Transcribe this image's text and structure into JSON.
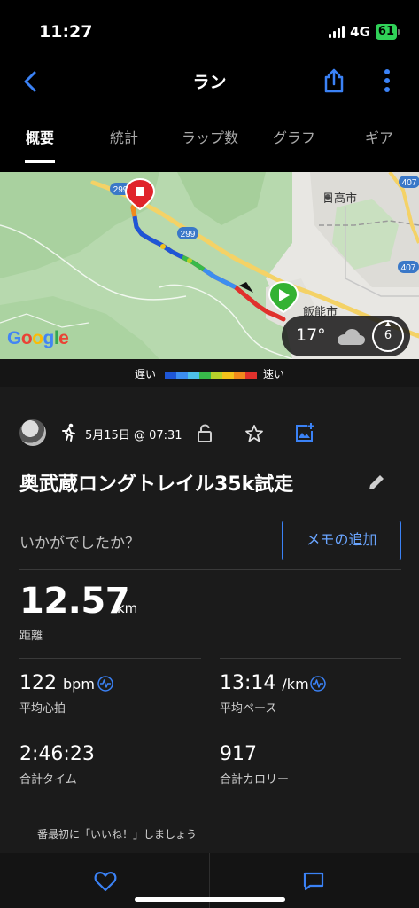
{
  "status_bar": {
    "time": "11:27",
    "network": "4G",
    "battery": "61"
  },
  "nav": {
    "title": "ラン"
  },
  "tabs": [
    {
      "label": "概要"
    },
    {
      "label": "統計"
    },
    {
      "label": "ラップ数"
    },
    {
      "label": "グラフ"
    },
    {
      "label": "ギア"
    }
  ],
  "map": {
    "place_labels": [
      "日高市",
      "飯能市"
    ],
    "road_numbers": [
      "299",
      "299",
      "407",
      "407"
    ],
    "weather": {
      "temp": "17°",
      "wind": "6"
    },
    "attribution": "Google"
  },
  "legend": {
    "slow": "遅い",
    "fast": "速い",
    "colors": [
      "#1e56d6",
      "#3c8ef0",
      "#4ec1e8",
      "#38b94a",
      "#b6d12a",
      "#f2c21b",
      "#f08a1c",
      "#e0312c"
    ]
  },
  "activity": {
    "date": "5月15日 @ 07:31",
    "title": "奥武蔵ロングトレイル35k試走",
    "prompt": "いかがでしたか？",
    "memo_button": "メモの追加"
  },
  "stats": {
    "distance": {
      "value": "12.57",
      "unit": "km",
      "label": "距離"
    },
    "avg_hr": {
      "value": "122",
      "unit": "bpm",
      "label": "平均心拍"
    },
    "avg_pace": {
      "value": "13:14",
      "unit": "/km",
      "label": "平均ペース"
    },
    "total_time": {
      "value": "2:46:23",
      "label": "合計タイム"
    },
    "calories": {
      "value": "917",
      "label": "合計カロリー"
    }
  },
  "like_prompt": "一番最初に「いいね！」しましょう",
  "colors": {
    "accent": "#3b82f6",
    "background": "#1b1b1b",
    "start": "#34b233",
    "finish": "#e0232b"
  }
}
